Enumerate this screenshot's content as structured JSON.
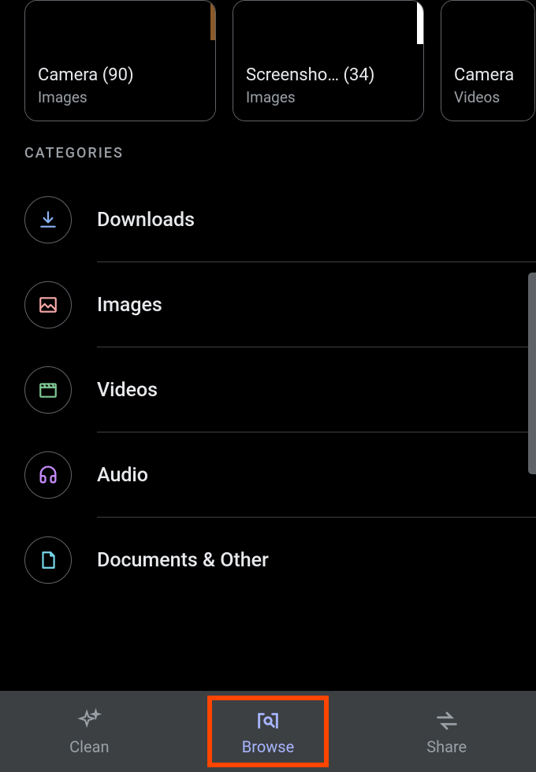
{
  "collections": [
    {
      "title": "Camera (90)",
      "subtitle": "Images"
    },
    {
      "title": "Screensho… (34)",
      "subtitle": "Images"
    },
    {
      "title": "Camera",
      "subtitle": "Videos"
    }
  ],
  "section_header": "CATEGORIES",
  "categories": [
    {
      "label": "Downloads",
      "icon": "download"
    },
    {
      "label": "Images",
      "icon": "image"
    },
    {
      "label": "Videos",
      "icon": "video"
    },
    {
      "label": "Audio",
      "icon": "audio"
    },
    {
      "label": "Documents & Other",
      "icon": "document"
    }
  ],
  "bottom_nav": [
    {
      "label": "Clean",
      "icon": "sparkle",
      "active": false
    },
    {
      "label": "Browse",
      "icon": "browse",
      "active": true
    },
    {
      "label": "Share",
      "icon": "share",
      "active": false
    }
  ]
}
